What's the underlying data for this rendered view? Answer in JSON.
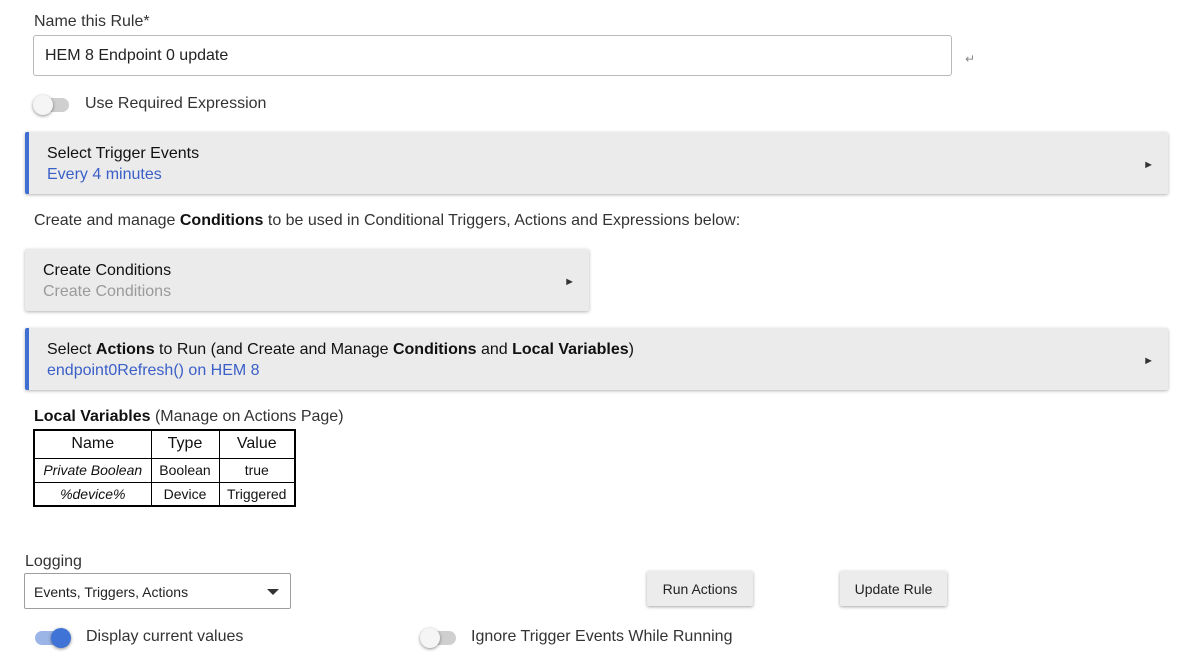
{
  "rule": {
    "name_label": "Name this Rule*",
    "name_value": "HEM 8 Endpoint 0 update"
  },
  "required_expression": {
    "label": "Use Required Expression",
    "on": false
  },
  "trigger": {
    "title": "Select Trigger Events",
    "value": "Every 4 minutes"
  },
  "conditions_info": {
    "prefix": "Create and manage ",
    "bold": "Conditions",
    "suffix": " to be used in Conditional Triggers, Actions and Expressions below:"
  },
  "conditions": {
    "title": "Create Conditions",
    "value": "Create Conditions"
  },
  "actions": {
    "t1": "Select ",
    "b1": "Actions",
    "t2": " to Run (and Create and Manage ",
    "b2": "Conditions",
    "t3": " and ",
    "b3": "Local Variables",
    "t4": ")",
    "value": "endpoint0Refresh() on HEM 8"
  },
  "local_variables": {
    "title": "Local Variables",
    "note": " (Manage on Actions Page)",
    "headers": [
      "Name",
      "Type",
      "Value"
    ],
    "rows": [
      [
        "Private Boolean",
        "Boolean",
        "true"
      ],
      [
        "%device%",
        "Device",
        "Triggered"
      ]
    ]
  },
  "logging": {
    "label": "Logging",
    "selected": "Events, Triggers, Actions"
  },
  "buttons": {
    "run_actions": "Run Actions",
    "update_rule": "Update Rule"
  },
  "display_values": {
    "label": "Display current values",
    "on": true
  },
  "ignore_triggers": {
    "label": "Ignore Trigger Events While Running",
    "on": false
  },
  "icons": {
    "enter": "↵",
    "arrow": "►"
  },
  "colors": {
    "accent": "#3f6fd1",
    "link": "#3a5fc8",
    "toggle_on": "#3f73d6"
  }
}
